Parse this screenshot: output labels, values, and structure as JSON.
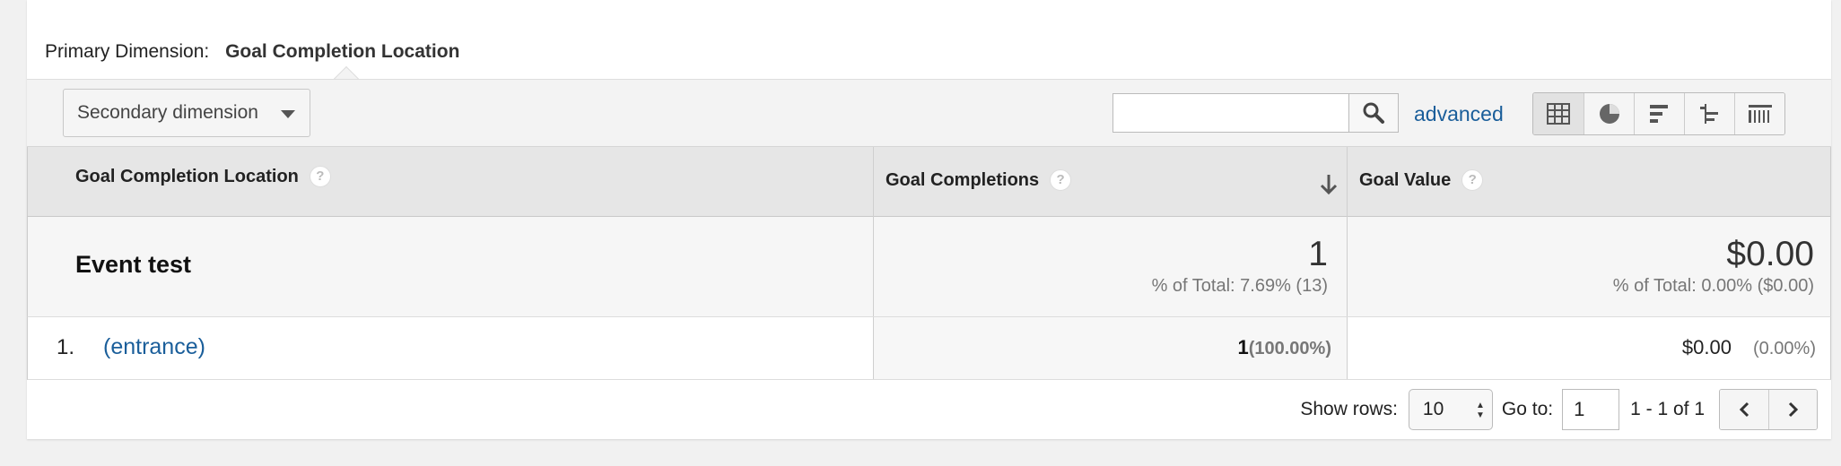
{
  "primary_dimension": {
    "label": "Primary Dimension:",
    "value": "Goal Completion Location"
  },
  "toolbar": {
    "secondary_dimension_label": "Secondary dimension",
    "search_value": "",
    "advanced_label": "advanced",
    "view_buttons": [
      "table-view-icon",
      "pie-chart-icon",
      "bar-chart-icon",
      "comparison-icon",
      "pivot-icon"
    ]
  },
  "table": {
    "columns": [
      {
        "label": "Goal Completion Location",
        "help": "?"
      },
      {
        "label": "Goal Completions",
        "help": "?",
        "sorted": "descending"
      },
      {
        "label": "Goal Value",
        "help": "?"
      }
    ],
    "total": {
      "name": "Event test",
      "goal_completions": "1",
      "goal_completions_sub": "% of Total: 7.69% (13)",
      "goal_value": "$0.00",
      "goal_value_sub": "% of Total: 0.00% ($0.00)"
    },
    "rows": [
      {
        "index": "1.",
        "location": "(entrance)",
        "goal_completions": "1",
        "goal_completions_pct": "(100.00%)",
        "goal_value": "$0.00",
        "goal_value_pct": "(0.00%)"
      }
    ]
  },
  "pager": {
    "show_rows_label": "Show rows:",
    "rows_value": "10",
    "go_to_label": "Go to:",
    "go_to_value": "1",
    "range_text": "1 - 1 of 1"
  },
  "colors": {
    "link": "#1a5e9a",
    "header_bg": "#e6e6e6",
    "toolbar_bg": "#f3f3f3"
  }
}
